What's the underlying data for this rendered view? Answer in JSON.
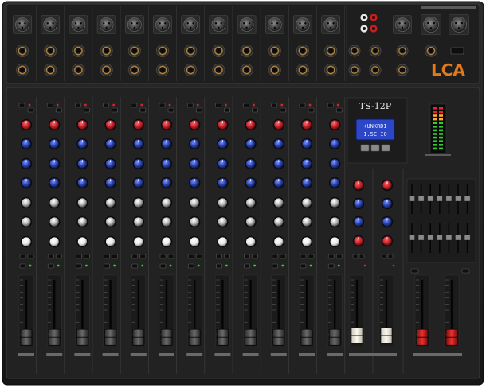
{
  "device": {
    "model": "TS-12P",
    "brand_logo": "LCA",
    "lcd_line1": "+UNKRDI",
    "lcd_line2": "1.5E I0",
    "mono_channel_count": 12,
    "stereo_channel_count": 2,
    "master_fader_count": 2
  },
  "colors": {
    "chassis": "#1a1a1a",
    "panel": "#242424",
    "gain_knob": "#c8202a",
    "eq_knob": "#2a44b0",
    "aux_knob": "#bfbfbf",
    "pan_knob": "#e8e8e8",
    "stereo_fader_cap": "#f2efe6",
    "master_fader_cap": "#d42424",
    "lcd_bg": "#2c46c8",
    "logo": "#e07a1c"
  },
  "fader_levels": {
    "mono": [
      0.05,
      0.05,
      0.05,
      0.05,
      0.05,
      0.05,
      0.05,
      0.05,
      0.05,
      0.05,
      0.05,
      0.05
    ],
    "stereo": [
      0.08,
      0.08
    ],
    "master": [
      0.05,
      0.05
    ]
  },
  "icons": {
    "xlr": "xlr-jack-icon",
    "jack": "quarter-inch-jack-icon",
    "rca": "rca-jack-icon",
    "button": "push-button-icon",
    "led": "led-icon"
  }
}
